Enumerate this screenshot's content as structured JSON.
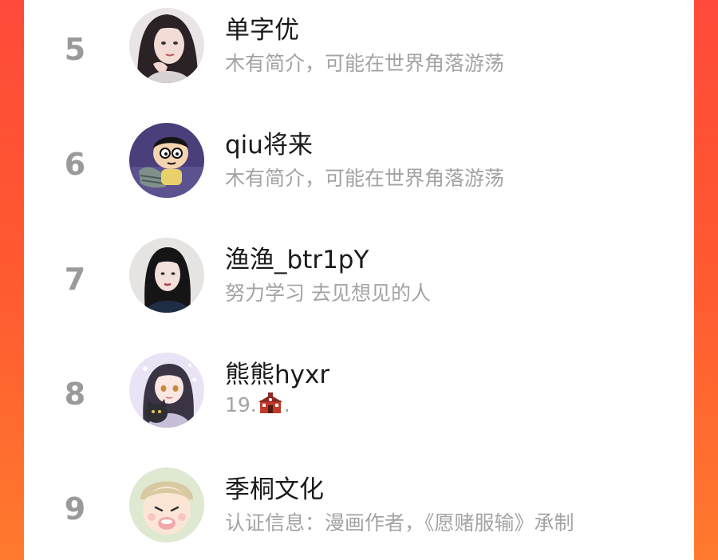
{
  "list": {
    "items": [
      {
        "rank": "5",
        "name": "单字优",
        "bio": "木有简介，可能在世界角落游荡",
        "avatar_icon": "avatar-girl-dark-hair"
      },
      {
        "rank": "6",
        "name": "qiu将来",
        "bio": "木有简介，可能在世界角落游荡",
        "avatar_icon": "avatar-cartoon-boy"
      },
      {
        "rank": "7",
        "name": "渔渔_btr1pY",
        "bio": "努力学习 去见想见的人",
        "avatar_icon": "avatar-girl-black-hair"
      },
      {
        "rank": "8",
        "name": "熊熊hyxr",
        "bio_prefix": "19.",
        "bio_suffix": ".",
        "bio_emoji": "school-emoji",
        "avatar_icon": "avatar-anime-girl-cat"
      },
      {
        "rank": "9",
        "name": "季桐文化",
        "bio": "认证信息：漫画作者，《愿赌服输》承制",
        "avatar_icon": "avatar-anime-baby"
      }
    ]
  },
  "colors": {
    "background_gradient_top": "#ff4a3a",
    "background_gradient_bottom": "#ff7a2e",
    "rank": "#9a9a9a",
    "name": "#1a1a1a",
    "bio": "#a3a3a3"
  }
}
